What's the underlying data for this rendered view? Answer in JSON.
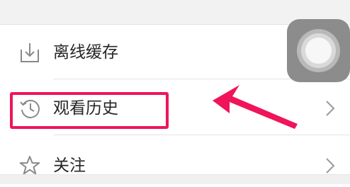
{
  "menu": {
    "items": [
      {
        "label": "离线缓存",
        "icon": "download-icon"
      },
      {
        "label": "观看历史",
        "icon": "history-clock-icon"
      },
      {
        "label": "关注",
        "icon": "star-outline-icon"
      }
    ]
  },
  "annotation": {
    "highlight_color": "#f0145a",
    "highlighted_item": "观看历史"
  },
  "colors": {
    "text": "#262626",
    "icon": "#8a8a8a",
    "divider": "#e3e3e3",
    "assistive_touch": "#8c8c8c"
  }
}
